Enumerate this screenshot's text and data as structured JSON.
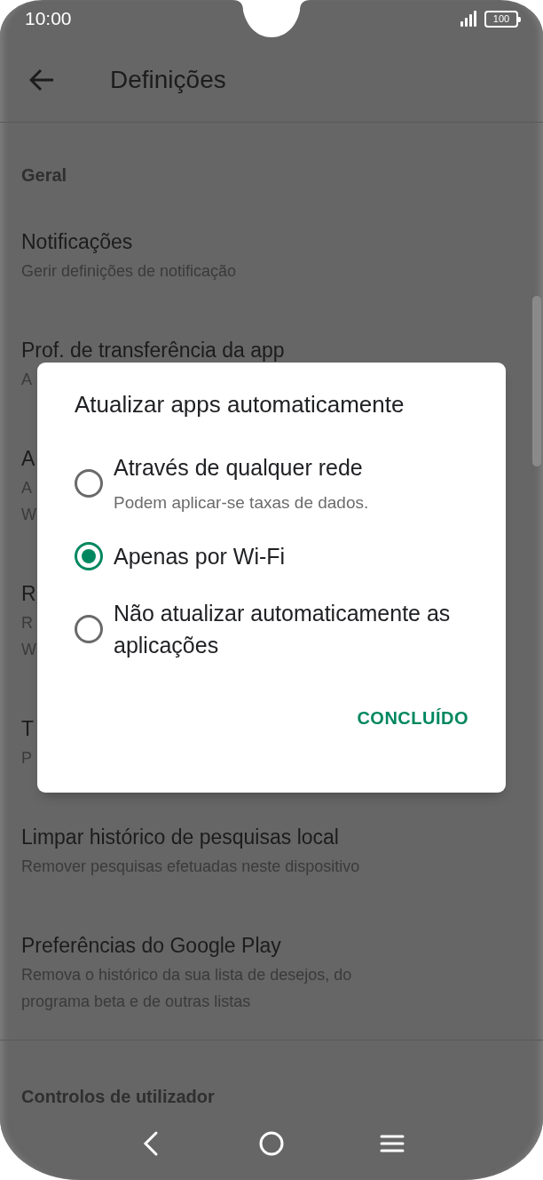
{
  "status_bar": {
    "time": "10:00",
    "battery": "100"
  },
  "toolbar": {
    "title": "Definições"
  },
  "sections": [
    {
      "header": "Geral",
      "items": [
        {
          "title": "Notificações",
          "subtitle_lines": [
            "Gerir definições de notificação"
          ]
        },
        {
          "title": "Prof. de transferência da app",
          "subtitle_lines": [
            "A"
          ]
        },
        {
          "title": "A",
          "subtitle_lines": [
            "A",
            "W"
          ]
        },
        {
          "title": "R",
          "subtitle_lines": [
            "R",
            "W"
          ]
        },
        {
          "title": "T",
          "subtitle_lines": [
            "P"
          ]
        },
        {
          "title": "Limpar histórico de pesquisas local",
          "subtitle_lines": [
            "Remover pesquisas efetuadas neste dispositivo"
          ]
        },
        {
          "title": "Preferências do Google Play",
          "subtitle_lines": [
            "Remova o histórico da sua lista de desejos, do",
            "programa beta e de outras listas"
          ]
        }
      ]
    },
    {
      "header": "Controlos de utilizador"
    }
  ],
  "dialog": {
    "title": "Atualizar apps automaticamente",
    "options": [
      {
        "label": "Através de qualquer rede",
        "description": "Podem aplicar-se taxas de dados.",
        "selected": false
      },
      {
        "label": "Apenas por Wi-Fi",
        "selected": true
      },
      {
        "label": "Não atualizar automaticamente as aplicações",
        "selected": false
      }
    ],
    "button": "CONCLUÍDO"
  }
}
